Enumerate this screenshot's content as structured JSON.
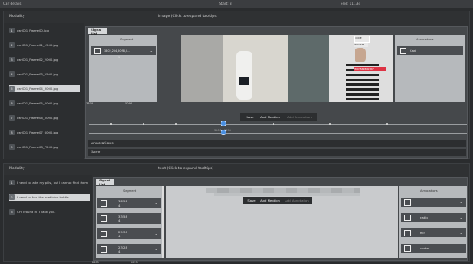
{
  "topbar": {
    "left": "Car details",
    "mid": "Start: 3",
    "right": "end: 11134"
  },
  "top_section": {
    "left_header": "Modality",
    "center_header": "image (Click to expand tooltips)",
    "items": [
      {
        "n": "1",
        "label": "car001_Frame00.jpg"
      },
      {
        "n": "2",
        "label": "car001_Frame01_1500.jpg"
      },
      {
        "n": "3",
        "label": "car001_Frame02_2000.jpg"
      },
      {
        "n": "4",
        "label": "car001_Frame03_2500.jpg"
      },
      {
        "n": "5",
        "label": "car001_Frame04_3000.jpg"
      },
      {
        "n": "6",
        "label": "car001_Frame05_4000.jpg"
      },
      {
        "n": "7",
        "label": "car001_Frame06_5000.jpg"
      },
      {
        "n": "8",
        "label": "car001_Frame07_6000.jpg"
      },
      {
        "n": "9",
        "label": "car001_Frame08_7200.jpg"
      }
    ],
    "signal_tab": "Signal List",
    "segment_header": "Segment",
    "segment_value": "3802,254,5098,0...",
    "segment_sub": "5",
    "annotations_header": "Annotations",
    "tag_label": "Cart",
    "bbox_label1": "CODE",
    "bbox_label2": "3802345",
    "bbox_label3": "3802562869367",
    "left_num": "3803",
    "mid_num": "5098",
    "save": "Save",
    "add_mention": "Add Mention",
    "add_annotation": "Add Annotation",
    "timeline_label": "3803 - 5098",
    "annotations_bar": "Annotations",
    "save_bar": "Save"
  },
  "bottom_section": {
    "left_header": "Modality",
    "center_header": "text (Click to expand tooltips)",
    "items": [
      {
        "n": "1",
        "label": "I need to take my pills, but I cannot find them."
      },
      {
        "n": "2",
        "label": "I need to find the medicine bottle"
      },
      {
        "n": "3",
        "label": "OH I found it. Thank you."
      }
    ],
    "signal_tab": "Signal List",
    "segment_header": "Segment",
    "annotations_header": "Annotations",
    "segments": [
      {
        "value": "38,58",
        "sub": "4"
      },
      {
        "value": "33,58",
        "sub": "4"
      },
      {
        "value": "29,30",
        "sub": "4"
      },
      {
        "value": "23,28",
        "sub": "4"
      }
    ],
    "tags": [
      {
        "label": ""
      },
      {
        "label": "radio"
      },
      {
        "label": "file"
      },
      {
        "label": "under"
      }
    ],
    "save": "Save",
    "add_mention": "Add Mention",
    "add_annotation": "Add Annotation",
    "bottom_left_num": "3803",
    "bottom_mid_num": "5023"
  },
  "colors": {
    "accent": "#4a90e2",
    "bg": "#2a2c2e",
    "selected": "#d4d6d8"
  }
}
